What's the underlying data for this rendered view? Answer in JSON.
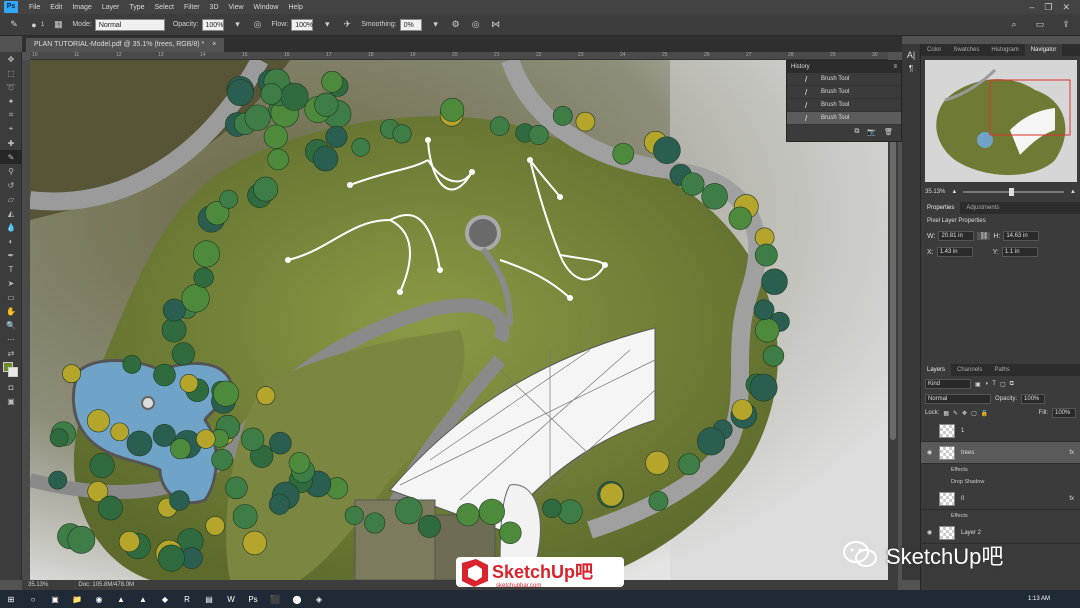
{
  "menubar": {
    "app_logo": "Ps",
    "items": [
      "File",
      "Edit",
      "Image",
      "Layer",
      "Type",
      "Select",
      "Filter",
      "3D",
      "View",
      "Window",
      "Help"
    ]
  },
  "options_bar": {
    "brush_size": "1",
    "mode_label": "Mode:",
    "mode_value": "Normal",
    "opacity_label": "Opacity:",
    "opacity_value": "100%",
    "flow_label": "Flow:",
    "flow_value": "100%",
    "smoothing_label": "Smoothing:",
    "smoothing_value": "0%"
  },
  "document": {
    "tab_title": "PLAN TUTORIAL-Model.pdf @ 35.1% (trees, RGB/8) *",
    "ruler_ticks": [
      "10",
      "11",
      "12",
      "13",
      "14",
      "15",
      "16",
      "17",
      "18",
      "19",
      "20",
      "21",
      "22",
      "23",
      "24",
      "25",
      "26",
      "27",
      "28",
      "29",
      "30"
    ]
  },
  "statusbar": {
    "zoom": "35.13%",
    "doc": "Doc: 105.8M/478.0M"
  },
  "history": {
    "title": "History",
    "rows": [
      "Brush Tool",
      "Brush Tool",
      "Brush Tool",
      "Brush Tool"
    ]
  },
  "panels": {
    "top_tabs": [
      "Color",
      "Swatches",
      "Histogram",
      "Navigator"
    ],
    "nav_zoom": "35.13%",
    "props_tabs": [
      "Properties",
      "Adjustments"
    ],
    "props_title": "Pixel Layer Properties",
    "w_label": "W:",
    "w_value": "20.81 in",
    "h_label": "H:",
    "h_value": "14.63 in",
    "x_label": "X:",
    "x_value": "1.43 in",
    "y_label": "Y:",
    "y_value": "1.1 in",
    "layers_tabs": [
      "Layers",
      "Channels",
      "Paths"
    ],
    "kind_value": "Kind",
    "blend_value": "Normal",
    "opacity_label": "Opacity:",
    "opacity_value": "100%",
    "lock_label": "Lock:",
    "fill_label": "Fill:",
    "fill_value": "100%",
    "layers": [
      {
        "name": "1",
        "selected": false
      },
      {
        "name": "trees",
        "selected": true,
        "effects": [
          "Effects",
          "Drop Shadow"
        ]
      },
      {
        "name": "0",
        "selected": false,
        "effects": [
          "Effects"
        ]
      },
      {
        "name": "Layer 2",
        "selected": false
      }
    ]
  },
  "watermarks": {
    "sketchup_logo": "SketchUp吧",
    "sketchup_url": "sketchupbar.com",
    "wechat_text": "SketchUp吧"
  },
  "taskbar": {
    "time": "1:13 AM"
  },
  "colors": {
    "grass": "#6f7a35",
    "water": "#6fa3c8",
    "path": "#8a8a8a",
    "building": "#f5f5f5",
    "ps_blue": "#31a8ff",
    "sketchup_red": "#d9232d"
  }
}
